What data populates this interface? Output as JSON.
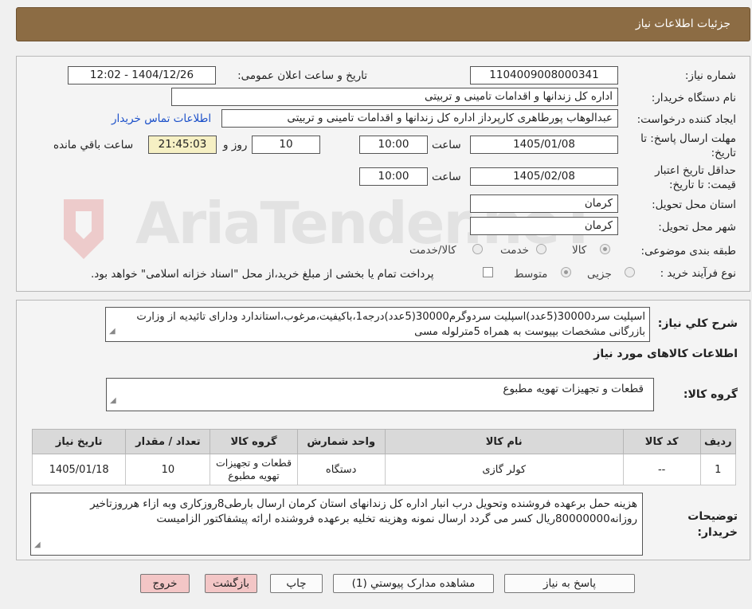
{
  "header": {
    "title": "جزئیات اطلاعات نیاز"
  },
  "form": {
    "need_number_label": "شماره نیاز:",
    "need_number": "1104009008000341",
    "announce_label": "تاریخ و ساعت اعلان عمومی:",
    "announce_value": "1404/12/26 - 12:02",
    "buyer_org_label": "نام دستگاه خریدار:",
    "buyer_org": "اداره کل زندانها و اقدامات تامینی و تربیتی",
    "creator_label": "ایجاد کننده درخواست:",
    "creator": "عبدالوهاب پورطاهری کارپرداز اداره کل زندانها و اقدامات تامینی و تربیتی",
    "contact_link": "اطلاعات تماس خریدار",
    "deadline_label": "مهلت ارسال پاسخ: تا تاریخ:",
    "deadline_date": "1405/01/08",
    "time_label": "ساعت",
    "deadline_time": "10:00",
    "days_value": "10",
    "days_label": "روز و",
    "remaining_time": "21:45:03",
    "remaining_label": "ساعت باقي مانده",
    "validity_label": "حداقل تاریخ اعتبار قیمت: تا تاریخ:",
    "validity_date": "1405/02/08",
    "validity_time": "10:00",
    "province_label": "استان محل تحویل:",
    "province": "کرمان",
    "city_label": "شهر محل تحویل:",
    "city": "کرمان",
    "category_label": "طبقه بندی موضوعی:",
    "category_options": [
      "کالا",
      "خدمت",
      "کالا/خدمت"
    ],
    "category_selected": "کالا",
    "process_label": "نوع فرآیند خرید :",
    "process_options": [
      "جزیی",
      "متوسط"
    ],
    "process_selected": "متوسط",
    "payment_note": "پرداخت تمام یا بخشی از مبلغ خرید،از محل \"اسناد خزانه اسلامی\" خواهد بود."
  },
  "watermark": {
    "text": "AriaTender.neT"
  },
  "summary": {
    "label": "شرح کلي نياز:",
    "text": "اسپلیت سرد30000(5عدد)اسپلیت سردوگرم30000(5عدد)درجه1،باکیفیت،مرغوب،استاندارد ودارای تائیدیه از وزارت بازرگانی مشخصات بپیوست به همراه 5مترلوله مسی"
  },
  "goods": {
    "section_title": "اطلاعات کالاهای مورد نیاز",
    "group_label": "گروه کالا:",
    "group_value": "قطعات و تجهیزات تهویه مطبوع",
    "table": {
      "headers": [
        "ردیف",
        "کد کالا",
        "نام کالا",
        "واحد شمارش",
        "گروه کالا",
        "تعداد / مقدار",
        "تاریخ نیاز"
      ],
      "rows": [
        [
          "1",
          "--",
          "کولر گازی",
          "دستگاه",
          "قطعات و تجهیزات تهویه مطبوع",
          "10",
          "1405/01/18"
        ]
      ]
    }
  },
  "buyer_notes": {
    "label": "توضیحات خریدار:",
    "text": "هزینه حمل برعهده فروشنده وتحویل درب انبار اداره کل زندانهای استان کرمان ارسال بارطی8روزکاری وبه ازاء هرروزتاخیر روزانه80000000ریال کسر می گردد ارسال نمونه وهزینه تخلیه برعهده فروشنده ارائه پیشفاکتور الزامیست"
  },
  "buttons": {
    "reply": "پاسخ به نیاز",
    "attachments": "مشاهده مدارک پیوستي (1)",
    "print": "چاپ",
    "back": "بازگشت",
    "exit": "خروج"
  }
}
